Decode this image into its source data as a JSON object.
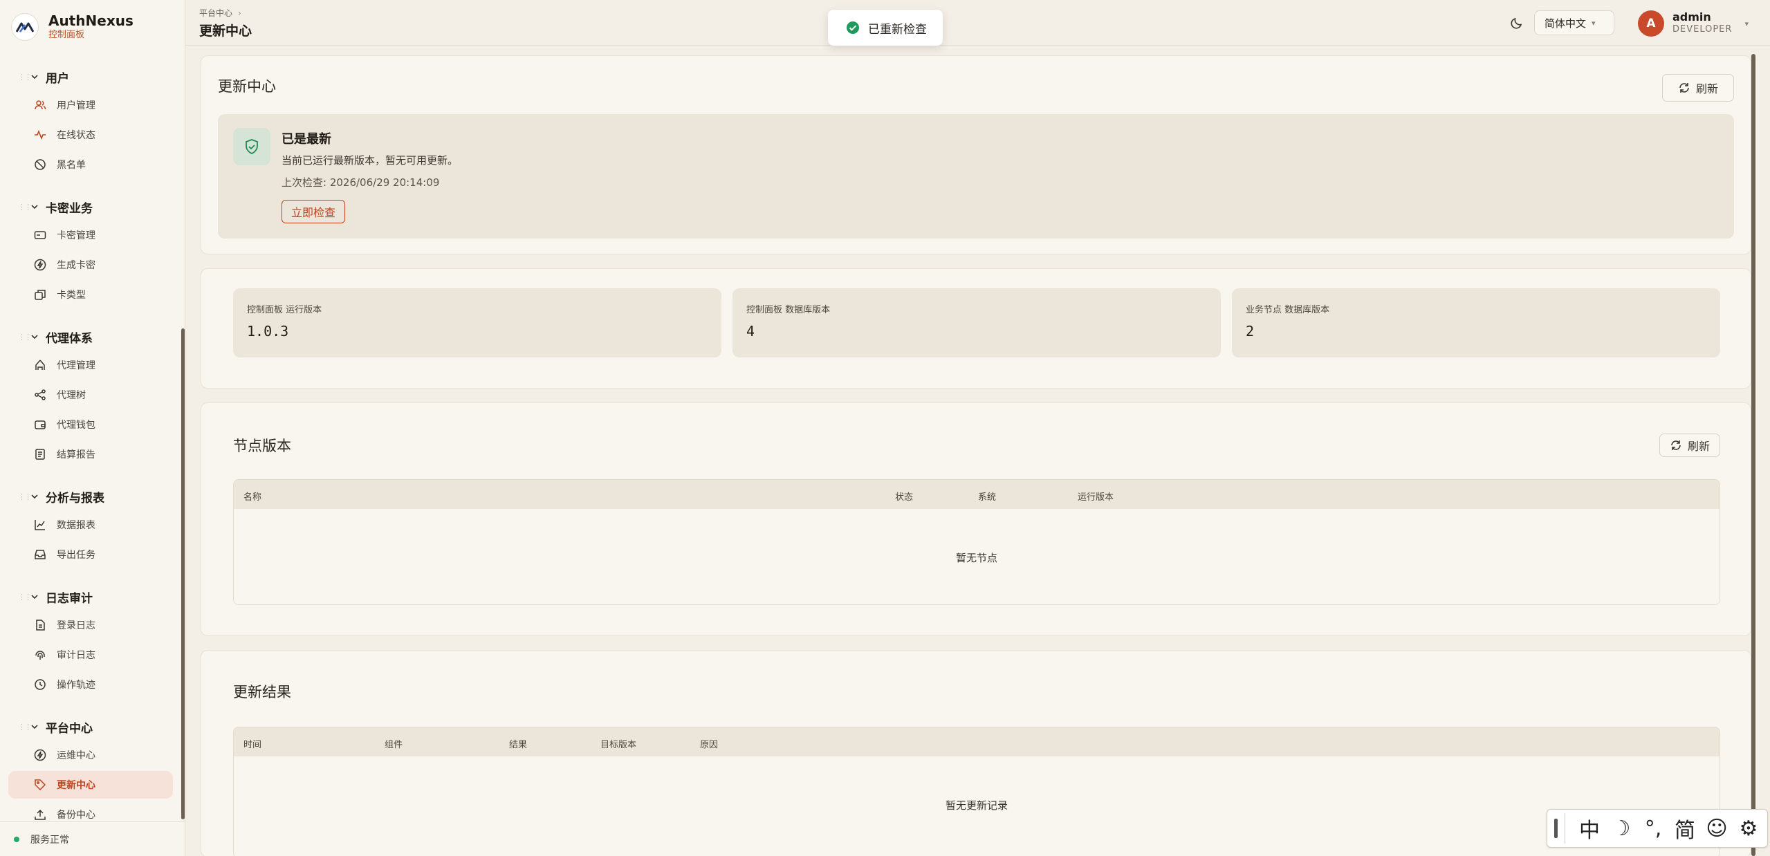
{
  "brand": {
    "name": "AuthNexus",
    "subtitle": "控制面板"
  },
  "sidebar": {
    "groups": [
      {
        "label": "用户",
        "items": [
          {
            "label": "用户管理",
            "icon": "users-icon"
          },
          {
            "label": "在线状态",
            "icon": "pulse-icon"
          },
          {
            "label": "黑名单",
            "icon": "ban-icon"
          }
        ]
      },
      {
        "label": "卡密业务",
        "items": [
          {
            "label": "卡密管理",
            "icon": "card-icon"
          },
          {
            "label": "生成卡密",
            "icon": "bolt-icon"
          },
          {
            "label": "卡类型",
            "icon": "layers-icon"
          }
        ]
      },
      {
        "label": "代理体系",
        "items": [
          {
            "label": "代理管理",
            "icon": "hierarchy-icon"
          },
          {
            "label": "代理树",
            "icon": "share-icon"
          },
          {
            "label": "代理钱包",
            "icon": "wallet-icon"
          },
          {
            "label": "结算报告",
            "icon": "report-icon"
          }
        ]
      },
      {
        "label": "分析与报表",
        "items": [
          {
            "label": "数据报表",
            "icon": "chart-icon"
          },
          {
            "label": "导出任务",
            "icon": "inbox-icon"
          }
        ]
      },
      {
        "label": "日志审计",
        "items": [
          {
            "label": "登录日志",
            "icon": "file-icon"
          },
          {
            "label": "审计日志",
            "icon": "fingerprint-icon"
          },
          {
            "label": "操作轨迹",
            "icon": "clock-icon"
          }
        ]
      },
      {
        "label": "平台中心",
        "items": [
          {
            "label": "运维中心",
            "icon": "bolt-icon"
          },
          {
            "label": "更新中心",
            "icon": "tag-icon",
            "active": true
          },
          {
            "label": "备份中心",
            "icon": "upload-icon"
          }
        ]
      }
    ],
    "footer_status": "服务正常"
  },
  "header": {
    "breadcrumb": "平台中心",
    "title": "更新中心",
    "language": "简体中文",
    "user": {
      "initial": "A",
      "name": "admin",
      "role": "DEVELOPER"
    }
  },
  "toast": {
    "text": "已重新检查"
  },
  "update_card": {
    "title": "更新中心",
    "refresh_label": "刷新",
    "status_title": "已是最新",
    "status_desc": "当前已运行最新版本，暂无可用更新。",
    "last_check": "上次检查: 2026/06/29 20:14:09",
    "check_button": "立即检查"
  },
  "versions": [
    {
      "label": "控制面板 运行版本",
      "value": "1.0.3"
    },
    {
      "label": "控制面板 数据库版本",
      "value": "4"
    },
    {
      "label": "业务节点 数据库版本",
      "value": "2"
    }
  ],
  "nodes": {
    "title": "节点版本",
    "refresh_label": "刷新",
    "columns": [
      "名称",
      "状态",
      "系统",
      "运行版本"
    ],
    "empty": "暂无节点"
  },
  "results": {
    "title": "更新结果",
    "columns": [
      "时间",
      "组件",
      "结果",
      "目标版本",
      "原因"
    ],
    "empty": "暂无更新记录"
  },
  "ime": {
    "buttons": [
      "中",
      "☽",
      "°,",
      "简",
      "☺",
      "⚙"
    ]
  },
  "colors": {
    "accent": "#c0431e",
    "success": "#25a86b",
    "panel": "#ece5d9",
    "background": "#f4efe6"
  }
}
